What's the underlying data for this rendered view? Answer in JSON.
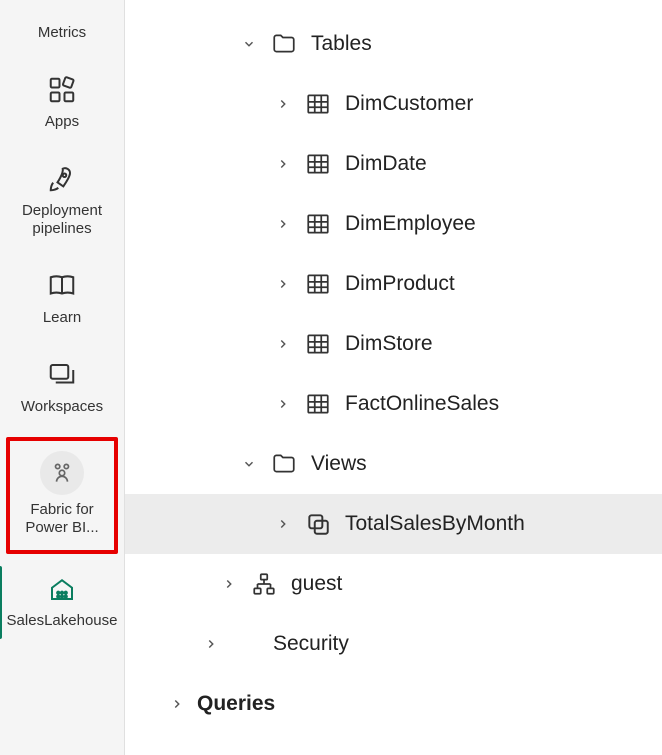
{
  "sidebar": {
    "items": [
      {
        "label": "Metrics"
      },
      {
        "label": "Apps"
      },
      {
        "label": "Deployment pipelines"
      },
      {
        "label": "Learn"
      },
      {
        "label": "Workspaces"
      },
      {
        "label": "Fabric for Power BI..."
      },
      {
        "label": "SalesLakehouse"
      }
    ]
  },
  "tree": {
    "tables_label": "Tables",
    "tables": [
      "DimCustomer",
      "DimDate",
      "DimEmployee",
      "DimProduct",
      "DimStore",
      "FactOnlineSales"
    ],
    "views_label": "Views",
    "views": [
      "TotalSalesByMonth"
    ],
    "guest_label": "guest",
    "security_label": "Security",
    "queries_label": "Queries"
  }
}
